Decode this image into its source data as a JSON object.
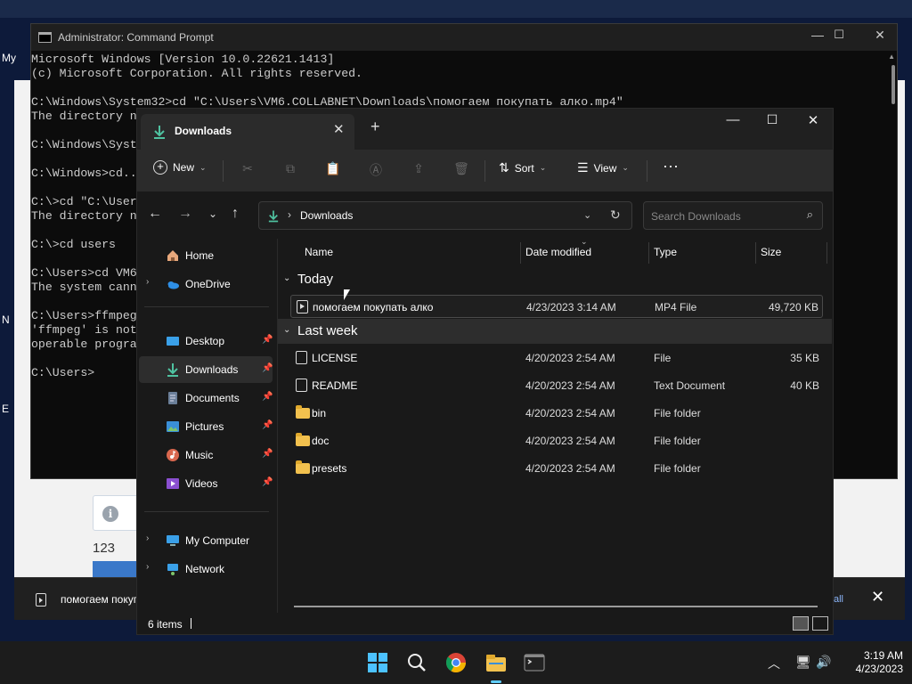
{
  "background": {
    "left_labels": [
      "My",
      "N",
      "E"
    ],
    "page_number": "123"
  },
  "download_bar": {
    "file_name": "помогаем покуп",
    "show_all": "all"
  },
  "cmd": {
    "title": "Administrator: Command Prompt",
    "lines": [
      "Microsoft Windows [Version 10.0.22621.1413]",
      "(c) Microsoft Corporation. All rights reserved.",
      "",
      "C:\\Windows\\System32>cd \"C:\\Users\\VM6.COLLABNET\\Downloads\\помогаем покупать алко.mp4\"",
      "The directory n",
      "",
      "C:\\Windows\\Syst",
      "",
      "C:\\Windows>cd..",
      "",
      "C:\\>cd \"C:\\User",
      "The directory n",
      "",
      "C:\\>cd users",
      "",
      "C:\\Users>cd VM6",
      "The system cann",
      "",
      "C:\\Users>ffmpeg",
      "'ffmpeg' is not",
      "operable progra",
      "",
      "C:\\Users>"
    ]
  },
  "explorer": {
    "tab_label": "Downloads",
    "toolbar": {
      "new_label": "New",
      "sort_label": "Sort",
      "view_label": "View"
    },
    "address": {
      "path": "Downloads",
      "search_placeholder": "Search Downloads"
    },
    "nav": {
      "home": "Home",
      "onedrive": "OneDrive",
      "desktop": "Desktop",
      "downloads": "Downloads",
      "documents": "Documents",
      "pictures": "Pictures",
      "music": "Music",
      "videos": "Videos",
      "my_computer": "My Computer",
      "network": "Network"
    },
    "columns": {
      "name": "Name",
      "date": "Date modified",
      "type": "Type",
      "size": "Size"
    },
    "groups": {
      "today": "Today",
      "last_week": "Last week"
    },
    "files_today": [
      {
        "name": "помогаем покупать алко",
        "date": "4/23/2023 3:14 AM",
        "type": "MP4 File",
        "size": "49,720 KB"
      }
    ],
    "files_last_week": [
      {
        "name": "LICENSE",
        "date": "4/20/2023 2:54 AM",
        "type": "File",
        "size": "35 KB"
      },
      {
        "name": "README",
        "date": "4/20/2023 2:54 AM",
        "type": "Text Document",
        "size": "40 KB"
      },
      {
        "name": "bin",
        "date": "4/20/2023 2:54 AM",
        "type": "File folder",
        "size": ""
      },
      {
        "name": "doc",
        "date": "4/20/2023 2:54 AM",
        "type": "File folder",
        "size": ""
      },
      {
        "name": "presets",
        "date": "4/20/2023 2:54 AM",
        "type": "File folder",
        "size": ""
      }
    ],
    "status": "6 items"
  },
  "taskbar": {
    "time": "3:19 AM",
    "date": "4/23/2023"
  }
}
